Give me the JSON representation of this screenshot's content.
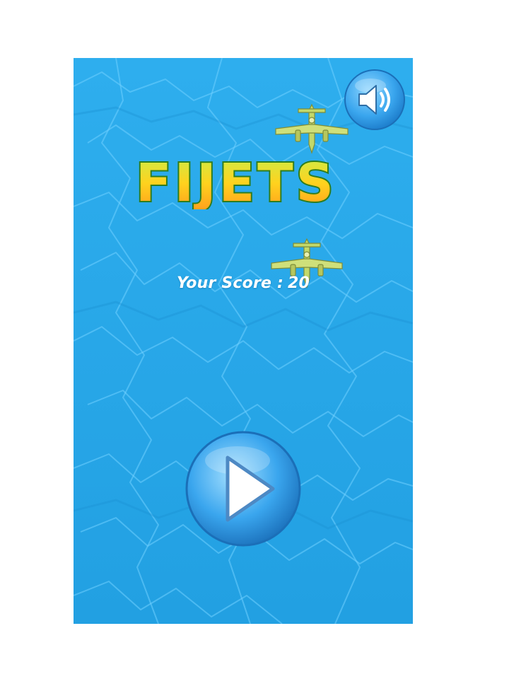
{
  "game": {
    "title": "FIJETS",
    "score_label": "Your Score :",
    "score_value": "20"
  },
  "icons": {
    "sound": "speaker-icon",
    "play": "play-icon",
    "plane": "airplane-icon"
  },
  "colors": {
    "water": "#2aa9ea",
    "title_top": "#c8f04a",
    "title_bottom": "#ff9a1c",
    "title_outline": "#2f7d1e",
    "button_blue": "#3aa6ee",
    "plane": "#c3d96a"
  }
}
